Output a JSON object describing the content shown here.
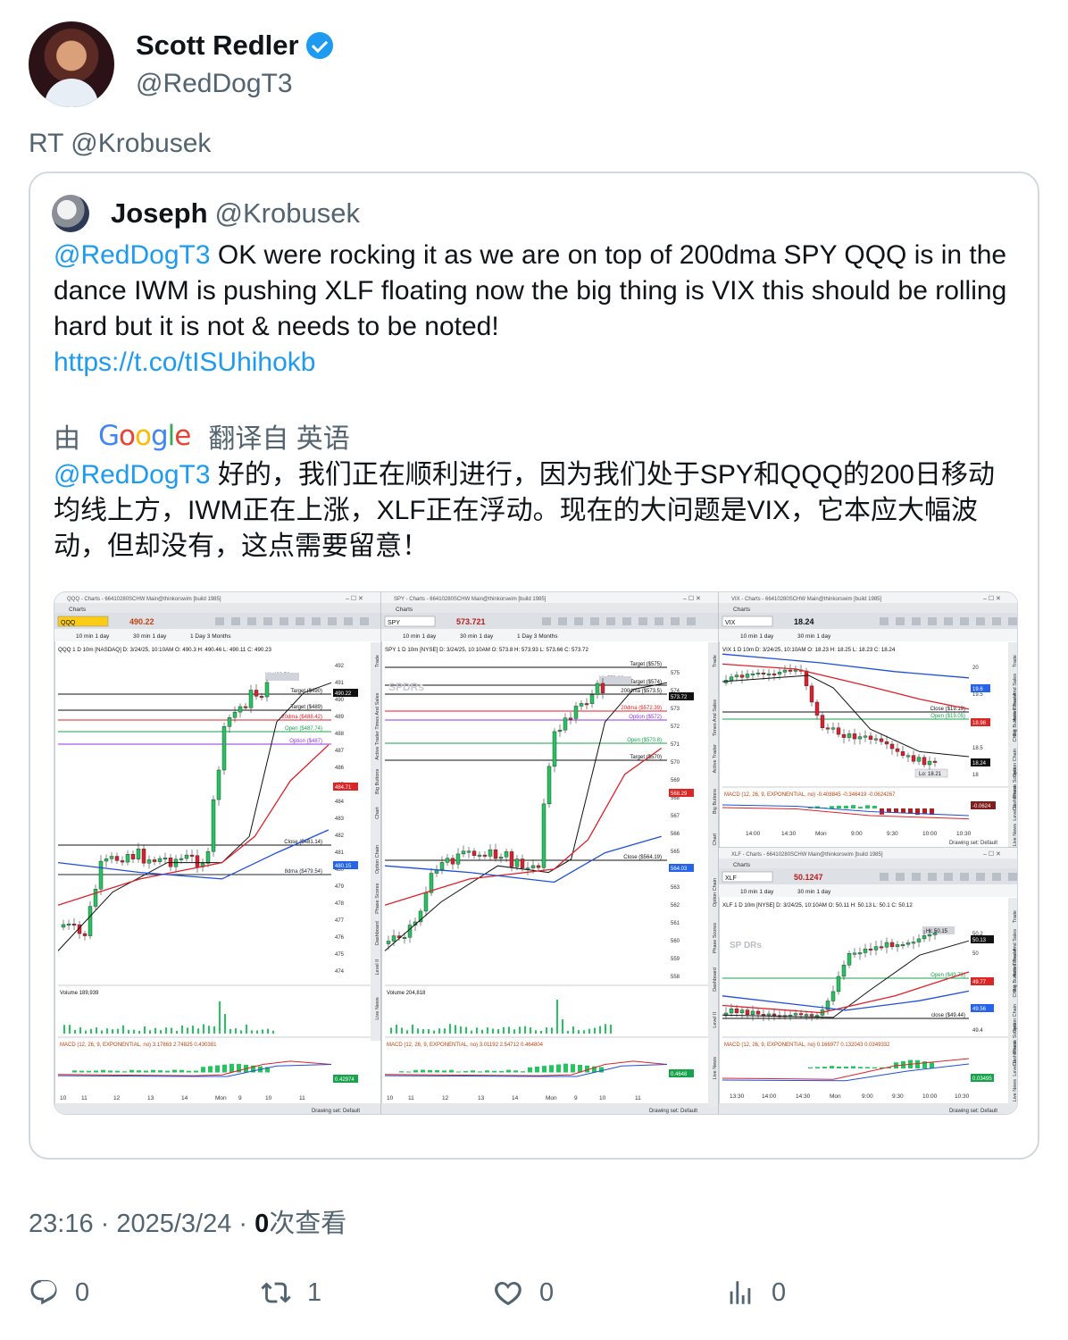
{
  "author": {
    "name": "Scott Redler",
    "handle": "@RedDogT3",
    "verified": true
  },
  "retweet_line": "RT @Krobusek",
  "quoted": {
    "name": "Joseph",
    "handle": "@Krobusek",
    "mention": "@RedDogT3",
    "text": " OK were rocking it as we are on top of 200dma SPY QQQ is in the dance IWM is pushing XLF floating now the big thing is VIX this should be rolling hard but it is not & needs to be noted!",
    "link": "https://t.co/tISUhihokb",
    "translation_prefix": "由",
    "translation_suffix": "翻译自 英语",
    "translated_mention": "@RedDogT3",
    "translated_text": " 好的，我们正在顺利进行，因为我们处于SPY和QQQ的200日移动均线上方，IWM正在上涨，XLF正在浮动。现在的大问题是VIX，它本应大幅波动，但却没有，这点需要留意！"
  },
  "charts": {
    "qqq": {
      "window_title": "QQQ - Charts - 66410280SCHW Main@thinkorswim [build 1985]",
      "tab": "Charts",
      "symbol": "QQQ",
      "price": "490.22",
      "header": "QQQ 1 D 10m [NASDAQ]  D: 3/24/25, 10:10AM  O: 490.3  H: 490.46  L: 490.11  C: 490.23",
      "levels": [
        "Hi: 490.52",
        "Target ($490)",
        "Target ($489)",
        "20dma ($488.42)",
        "Open ($487.74)",
        "Option ($487)",
        "Close ($481.14)",
        "8dma ($479.54)"
      ],
      "price_tags": [
        "490.22",
        "484.71",
        "480.15"
      ],
      "y_ticks": [
        "492",
        "491",
        "490",
        "489",
        "488",
        "487",
        "486",
        "485",
        "484",
        "483",
        "482",
        "481",
        "480",
        "479",
        "478",
        "477",
        "476",
        "475",
        "474"
      ],
      "volume_label": "Volume  189,939",
      "macd_label": "MACD (12, 26, 9, EXPONENTIAL, no)  3.17863  2.74825  0.430381",
      "macd_tag": "0.42974",
      "x_ticks": [
        "10",
        "11",
        "12",
        "13",
        "14",
        "Mon",
        "9",
        "10",
        "11"
      ],
      "toolbar": [
        "10 min 1 day",
        "30 min 1 day",
        "1 Day 3 Months"
      ]
    },
    "spy": {
      "window_title": "SPY - Charts - 66410280SCHW Main@thinkorswim [build 1985]",
      "tab": "Charts",
      "symbol": "SPY",
      "price": "573.721",
      "header": "SPY 1 D 10m [NYSE]  D: 3/24/25, 10:10AM  O: 573.8  H: 573.93  L: 573.66  C: 573.72",
      "levels": [
        "Hi: 573.98",
        "Target ($575)",
        "Target ($574)",
        "200dma ($573.5)",
        "20dma ($572.39)",
        "Option ($572)",
        "Open ($570.8)",
        "Target ($570)",
        "Close ($564.19)"
      ],
      "price_tags": [
        "573.72",
        "568.29",
        "564.03"
      ],
      "y_ticks": [
        "575",
        "574",
        "573",
        "572",
        "571",
        "570",
        "569",
        "568",
        "567",
        "566",
        "565",
        "564",
        "563",
        "562",
        "561",
        "560",
        "559",
        "558"
      ],
      "volume_label": "Volume  204,818",
      "macd_label": "MACD (12, 26, 9, EXPONENTIAL, no)  3.01192  2.54712  0.464804",
      "macd_tag": "0.4648",
      "x_ticks": [
        "10",
        "11",
        "12",
        "13",
        "14",
        "Mon",
        "9",
        "10",
        "11"
      ],
      "toolbar": [
        "10 min 1 day",
        "30 min 1 day",
        "1 Day 3 Months"
      ]
    },
    "vix": {
      "window_title": "VIX - Charts - 66410280SCHW Main@thinkorswim [build 1985]",
      "tab": "Charts",
      "symbol": "VIX",
      "price": "18.24",
      "header": "VIX 1 D 10m  D: 3/24/25, 10:10AM  O: 18.23  H: 18.25  L: 18.23  C: 18.24",
      "levels": [
        "Close ($19.19)",
        "Open ($19.05)",
        "Lo: 18.21"
      ],
      "price_tags": [
        "19.6",
        "18.98",
        "18.24"
      ],
      "y_ticks": [
        "20",
        "19.5",
        "18.5",
        "18"
      ],
      "macd_label": "MACD (12, 26, 9, EXPONENTIAL, no)  -0.408845  -0.346419  -0.0624267",
      "macd_tag": "-0.0624",
      "x_ticks": [
        "14:00",
        "14:30",
        "Mon",
        "9:00",
        "9:30",
        "10:00",
        "10:30"
      ],
      "toolbar": [
        "10 min 1 day",
        "30 min 1 day"
      ]
    },
    "xlf": {
      "window_title": "XLF - Charts - 66410280SCHW Main@thinkorswim [build 1985]",
      "tab": "Charts",
      "symbol": "XLF",
      "price": "50.1247",
      "header": "XLF 1 D 10m [NYSE]  D: 3/24/25, 10:10AM  O: 50.11  H: 50.13  L: 50.1  C: 50.12",
      "levels": [
        "Hi: 50.15",
        "Open ($49.79)",
        "close ($49.44)"
      ],
      "price_tags": [
        "50.13",
        "49.77",
        "49.56",
        "0.03495"
      ],
      "y_ticks": [
        "50.2",
        "50",
        "49.4"
      ],
      "macd_label": "MACD (12, 26, 9, EXPONENTIAL, no)  0.166977  0.132043  0.0349332",
      "x_ticks": [
        "13:30",
        "14:00",
        "14:30",
        "Mon",
        "9:00",
        "9:30",
        "10:00",
        "10:30"
      ],
      "toolbar": [
        "10 min 1 day",
        "30 min 1 day"
      ]
    },
    "drawing_set": "Drawing set: Default",
    "side_tabs": [
      "Trade",
      "Times And Sales",
      "Active Trader",
      "Big Buttons",
      "Chart",
      "Option Chain",
      "Phase Scores",
      "Dashboard",
      "Level II",
      "Live News"
    ]
  },
  "meta": {
    "time": "23:16 · 2025/3/24 · ",
    "views": "0",
    "views_label": "次查看"
  },
  "actions": {
    "replies": "0",
    "retweets": "1",
    "likes": "0",
    "views": "0"
  },
  "colors": {
    "link": "#1d9bf0",
    "muted": "#536471",
    "up_candle": "#22c55e",
    "down_candle": "#e11d2e",
    "ma_red": "#e0202a",
    "ma_blue": "#1f4fd8"
  }
}
